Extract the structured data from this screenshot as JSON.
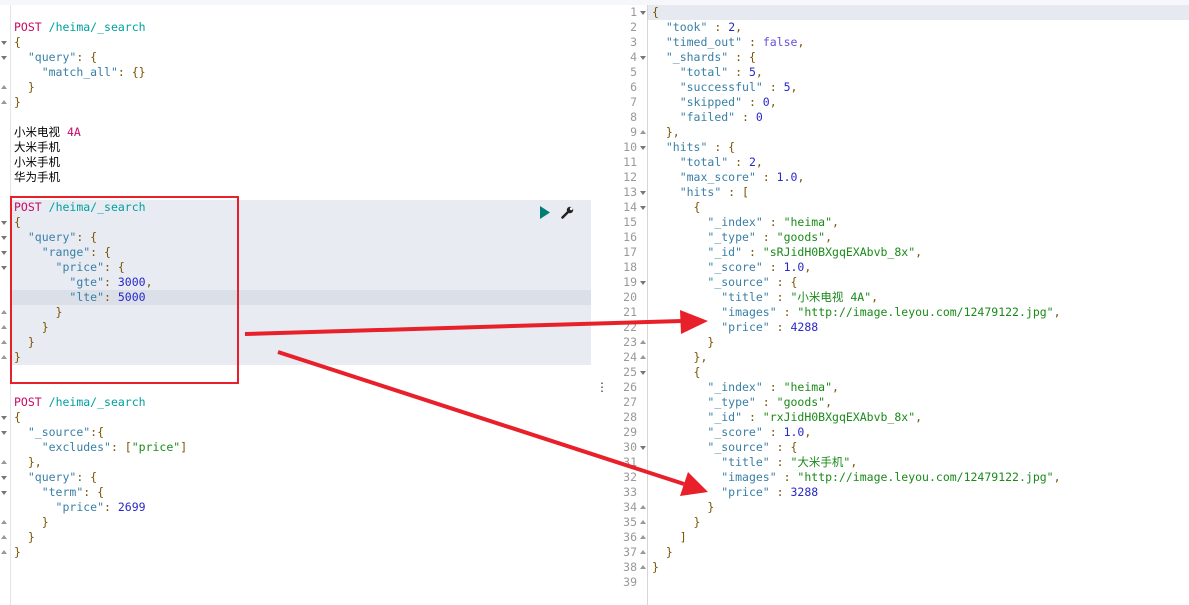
{
  "left": {
    "lines": [
      [],
      [
        [
          "m",
          "POST"
        ],
        [
          "t",
          " "
        ],
        [
          "u",
          "/heima/_search"
        ]
      ],
      [
        [
          "p",
          "{"
        ]
      ],
      [
        [
          "t",
          "  "
        ],
        [
          "k",
          "\"query\""
        ],
        [
          "p",
          ": {"
        ]
      ],
      [
        [
          "t",
          "    "
        ],
        [
          "k",
          "\"match_all\""
        ],
        [
          "p",
          ": {}"
        ]
      ],
      [
        [
          "t",
          "  "
        ],
        [
          "p",
          "}"
        ]
      ],
      [
        [
          "p",
          "}"
        ]
      ],
      [],
      [
        [
          "t",
          "小米电视 "
        ],
        [
          "m",
          "4A"
        ]
      ],
      [
        [
          "t",
          "大米手机"
        ]
      ],
      [
        [
          "t",
          "小米手机"
        ]
      ],
      [
        [
          "t",
          "华为手机"
        ]
      ],
      [],
      [
        [
          "m",
          "POST"
        ],
        [
          "t",
          " "
        ],
        [
          "u",
          "/heima/_search"
        ]
      ],
      [
        [
          "p",
          "{"
        ]
      ],
      [
        [
          "t",
          "  "
        ],
        [
          "k",
          "\"query\""
        ],
        [
          "p",
          ": {"
        ]
      ],
      [
        [
          "t",
          "    "
        ],
        [
          "k",
          "\"range\""
        ],
        [
          "p",
          ": {"
        ]
      ],
      [
        [
          "t",
          "      "
        ],
        [
          "k",
          "\"price\""
        ],
        [
          "p",
          ": {"
        ]
      ],
      [
        [
          "t",
          "        "
        ],
        [
          "k",
          "\"gte\""
        ],
        [
          "p",
          ": "
        ],
        [
          "n",
          "3000"
        ],
        [
          "p",
          ","
        ]
      ],
      [
        [
          "t",
          "        "
        ],
        [
          "k",
          "\"lte\""
        ],
        [
          "p",
          ": "
        ],
        [
          "n",
          "5000"
        ]
      ],
      [
        [
          "t",
          "      "
        ],
        [
          "p",
          "}"
        ]
      ],
      [
        [
          "t",
          "    "
        ],
        [
          "p",
          "}"
        ]
      ],
      [
        [
          "t",
          "  "
        ],
        [
          "p",
          "}"
        ]
      ],
      [
        [
          "p",
          "}"
        ]
      ],
      [],
      [],
      [
        [
          "m",
          "POST"
        ],
        [
          "t",
          " "
        ],
        [
          "u",
          "/heima/_search"
        ]
      ],
      [
        [
          "p",
          "{"
        ]
      ],
      [
        [
          "t",
          "  "
        ],
        [
          "k",
          "\"_source\""
        ],
        [
          "p",
          ":{"
        ]
      ],
      [
        [
          "t",
          "    "
        ],
        [
          "k",
          "\"excludes\""
        ],
        [
          "p",
          ": ["
        ],
        [
          "s",
          "\"price\""
        ],
        [
          "p",
          "]"
        ]
      ],
      [
        [
          "t",
          "  "
        ],
        [
          "p",
          "},"
        ]
      ],
      [
        [
          "t",
          "  "
        ],
        [
          "k",
          "\"query\""
        ],
        [
          "p",
          ": {"
        ]
      ],
      [
        [
          "t",
          "    "
        ],
        [
          "k",
          "\"term\""
        ],
        [
          "p",
          ": {"
        ]
      ],
      [
        [
          "t",
          "      "
        ],
        [
          "k",
          "\"price\""
        ],
        [
          "p",
          ": "
        ],
        [
          "n",
          "2699"
        ]
      ],
      [
        [
          "t",
          "    "
        ],
        [
          "p",
          "}"
        ]
      ],
      [
        [
          "t",
          "  "
        ],
        [
          "p",
          "}"
        ]
      ],
      [
        [
          "p",
          "}"
        ]
      ]
    ],
    "fold_down": [
      2,
      3,
      14,
      15,
      16,
      17,
      27,
      28,
      31,
      32
    ],
    "fold_up": [
      5,
      6,
      20,
      21,
      22,
      23,
      30,
      34,
      35,
      36
    ],
    "actions": {
      "run_icon": "play-icon",
      "settings_icon": "wrench-icon"
    }
  },
  "right": {
    "line_numbers": [
      "1",
      "2",
      "3",
      "4",
      "5",
      "6",
      "7",
      "8",
      "9",
      "10",
      "11",
      "12",
      "13",
      "14",
      "15",
      "16",
      "17",
      "18",
      "19",
      "20",
      "21",
      "22",
      "23",
      "24",
      "25",
      "26",
      "27",
      "28",
      "29",
      "30",
      "31",
      "32",
      "33",
      "34",
      "35",
      "36",
      "37",
      "38",
      "39"
    ],
    "lines": [
      [
        [
          "p",
          "{"
        ]
      ],
      [
        [
          "t",
          "  "
        ],
        [
          "k",
          "\"took\""
        ],
        [
          "p",
          " : "
        ],
        [
          "n",
          "2"
        ],
        [
          "p",
          ","
        ]
      ],
      [
        [
          "t",
          "  "
        ],
        [
          "k",
          "\"timed_out\""
        ],
        [
          "p",
          " : "
        ],
        [
          "b",
          "false"
        ],
        [
          "p",
          ","
        ]
      ],
      [
        [
          "t",
          "  "
        ],
        [
          "k",
          "\"_shards\""
        ],
        [
          "p",
          " : {"
        ]
      ],
      [
        [
          "t",
          "    "
        ],
        [
          "k",
          "\"total\""
        ],
        [
          "p",
          " : "
        ],
        [
          "n",
          "5"
        ],
        [
          "p",
          ","
        ]
      ],
      [
        [
          "t",
          "    "
        ],
        [
          "k",
          "\"successful\""
        ],
        [
          "p",
          " : "
        ],
        [
          "n",
          "5"
        ],
        [
          "p",
          ","
        ]
      ],
      [
        [
          "t",
          "    "
        ],
        [
          "k",
          "\"skipped\""
        ],
        [
          "p",
          " : "
        ],
        [
          "n",
          "0"
        ],
        [
          "p",
          ","
        ]
      ],
      [
        [
          "t",
          "    "
        ],
        [
          "k",
          "\"failed\""
        ],
        [
          "p",
          " : "
        ],
        [
          "n",
          "0"
        ]
      ],
      [
        [
          "t",
          "  "
        ],
        [
          "p",
          "},"
        ]
      ],
      [
        [
          "t",
          "  "
        ],
        [
          "k",
          "\"hits\""
        ],
        [
          "p",
          " : {"
        ]
      ],
      [
        [
          "t",
          "    "
        ],
        [
          "k",
          "\"total\""
        ],
        [
          "p",
          " : "
        ],
        [
          "n",
          "2"
        ],
        [
          "p",
          ","
        ]
      ],
      [
        [
          "t",
          "    "
        ],
        [
          "k",
          "\"max_score\""
        ],
        [
          "p",
          " : "
        ],
        [
          "n",
          "1.0"
        ],
        [
          "p",
          ","
        ]
      ],
      [
        [
          "t",
          "    "
        ],
        [
          "k",
          "\"hits\""
        ],
        [
          "p",
          " : ["
        ]
      ],
      [
        [
          "t",
          "      "
        ],
        [
          "p",
          "{"
        ]
      ],
      [
        [
          "t",
          "        "
        ],
        [
          "k",
          "\"_index\""
        ],
        [
          "p",
          " : "
        ],
        [
          "s",
          "\"heima\""
        ],
        [
          "p",
          ","
        ]
      ],
      [
        [
          "t",
          "        "
        ],
        [
          "k",
          "\"_type\""
        ],
        [
          "p",
          " : "
        ],
        [
          "s",
          "\"goods\""
        ],
        [
          "p",
          ","
        ]
      ],
      [
        [
          "t",
          "        "
        ],
        [
          "k",
          "\"_id\""
        ],
        [
          "p",
          " : "
        ],
        [
          "s",
          "\"sRJidH0BXgqEXAbvb_8x\""
        ],
        [
          "p",
          ","
        ]
      ],
      [
        [
          "t",
          "        "
        ],
        [
          "k",
          "\"_score\""
        ],
        [
          "p",
          " : "
        ],
        [
          "n",
          "1.0"
        ],
        [
          "p",
          ","
        ]
      ],
      [
        [
          "t",
          "        "
        ],
        [
          "k",
          "\"_source\""
        ],
        [
          "p",
          " : {"
        ]
      ],
      [
        [
          "t",
          "          "
        ],
        [
          "k",
          "\"title\""
        ],
        [
          "p",
          " : "
        ],
        [
          "s",
          "\"小米电视 4A\""
        ],
        [
          "p",
          ","
        ]
      ],
      [
        [
          "t",
          "          "
        ],
        [
          "k",
          "\"images\""
        ],
        [
          "p",
          " : "
        ],
        [
          "s",
          "\"http://image.leyou.com/12479122.jpg\""
        ],
        [
          "p",
          ","
        ]
      ],
      [
        [
          "t",
          "          "
        ],
        [
          "k",
          "\"price\""
        ],
        [
          "p",
          " : "
        ],
        [
          "n",
          "4288"
        ]
      ],
      [
        [
          "t",
          "        "
        ],
        [
          "p",
          "}"
        ]
      ],
      [
        [
          "t",
          "      "
        ],
        [
          "p",
          "},"
        ]
      ],
      [
        [
          "t",
          "      "
        ],
        [
          "p",
          "{"
        ]
      ],
      [
        [
          "t",
          "        "
        ],
        [
          "k",
          "\"_index\""
        ],
        [
          "p",
          " : "
        ],
        [
          "s",
          "\"heima\""
        ],
        [
          "p",
          ","
        ]
      ],
      [
        [
          "t",
          "        "
        ],
        [
          "k",
          "\"_type\""
        ],
        [
          "p",
          " : "
        ],
        [
          "s",
          "\"goods\""
        ],
        [
          "p",
          ","
        ]
      ],
      [
        [
          "t",
          "        "
        ],
        [
          "k",
          "\"_id\""
        ],
        [
          "p",
          " : "
        ],
        [
          "s",
          "\"rxJidH0BXgqEXAbvb_8x\""
        ],
        [
          "p",
          ","
        ]
      ],
      [
        [
          "t",
          "        "
        ],
        [
          "k",
          "\"_score\""
        ],
        [
          "p",
          " : "
        ],
        [
          "n",
          "1.0"
        ],
        [
          "p",
          ","
        ]
      ],
      [
        [
          "t",
          "        "
        ],
        [
          "k",
          "\"_source\""
        ],
        [
          "p",
          " : {"
        ]
      ],
      [
        [
          "t",
          "          "
        ],
        [
          "k",
          "\"title\""
        ],
        [
          "p",
          " : "
        ],
        [
          "s",
          "\"大米手机\""
        ],
        [
          "p",
          ","
        ]
      ],
      [
        [
          "t",
          "          "
        ],
        [
          "k",
          "\"images\""
        ],
        [
          "p",
          " : "
        ],
        [
          "s",
          "\"http://image.leyou.com/12479122.jpg\""
        ],
        [
          "p",
          ","
        ]
      ],
      [
        [
          "t",
          "          "
        ],
        [
          "k",
          "\"price\""
        ],
        [
          "p",
          " : "
        ],
        [
          "n",
          "3288"
        ]
      ],
      [
        [
          "t",
          "        "
        ],
        [
          "p",
          "}"
        ]
      ],
      [
        [
          "t",
          "      "
        ],
        [
          "p",
          "}"
        ]
      ],
      [
        [
          "t",
          "    "
        ],
        [
          "p",
          "]"
        ]
      ],
      [
        [
          "t",
          "  "
        ],
        [
          "p",
          "}"
        ]
      ],
      [
        [
          "p",
          "}"
        ]
      ],
      []
    ],
    "fold_down": [
      1,
      4,
      10,
      13,
      14,
      19,
      25,
      30
    ],
    "fold_up": [
      9,
      23,
      24,
      34,
      35,
      36,
      37,
      38
    ]
  },
  "annotation": {
    "color": "#e8202a"
  },
  "divider_glyph": "⋮"
}
